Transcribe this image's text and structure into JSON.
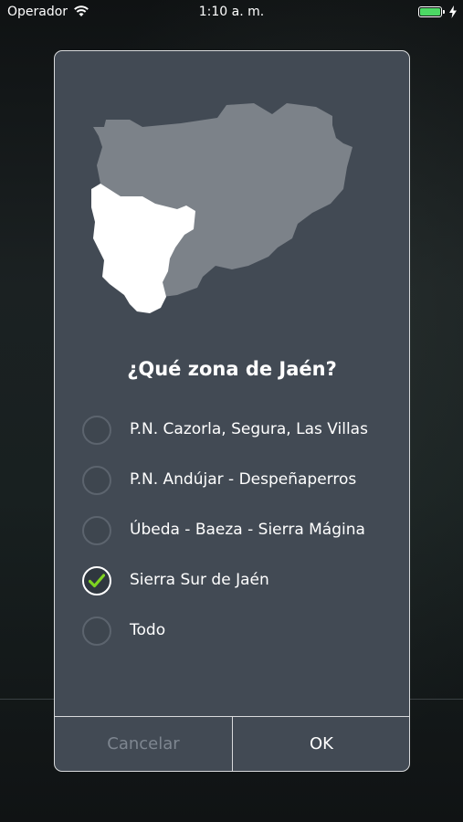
{
  "status_bar": {
    "carrier": "Operador",
    "time": "1:10 a. m.",
    "battery_level": 1.0,
    "battery_color": "#4cd964",
    "icons": [
      "wifi-icon",
      "battery-icon",
      "charging-icon"
    ]
  },
  "dialog": {
    "map_icon": "jaen-province-map",
    "title": "¿Qué zona de Jaén?",
    "options": [
      {
        "label": "P.N. Cazorla, Segura, Las Villas",
        "checked": false
      },
      {
        "label": "P.N. Andújar - Despeñaperros",
        "checked": false
      },
      {
        "label": "Úbeda - Baeza - Sierra Mágina",
        "checked": false
      },
      {
        "label": "Sierra Sur de Jaén",
        "checked": true
      },
      {
        "label": "Todo",
        "checked": false
      }
    ],
    "cancel_label": "Cancelar",
    "ok_label": "OK"
  },
  "colors": {
    "dialog_bg": "#424a54",
    "check_green": "#7ed321",
    "map_region_inactive": "#7c8289",
    "map_region_selected": "#ffffff"
  }
}
